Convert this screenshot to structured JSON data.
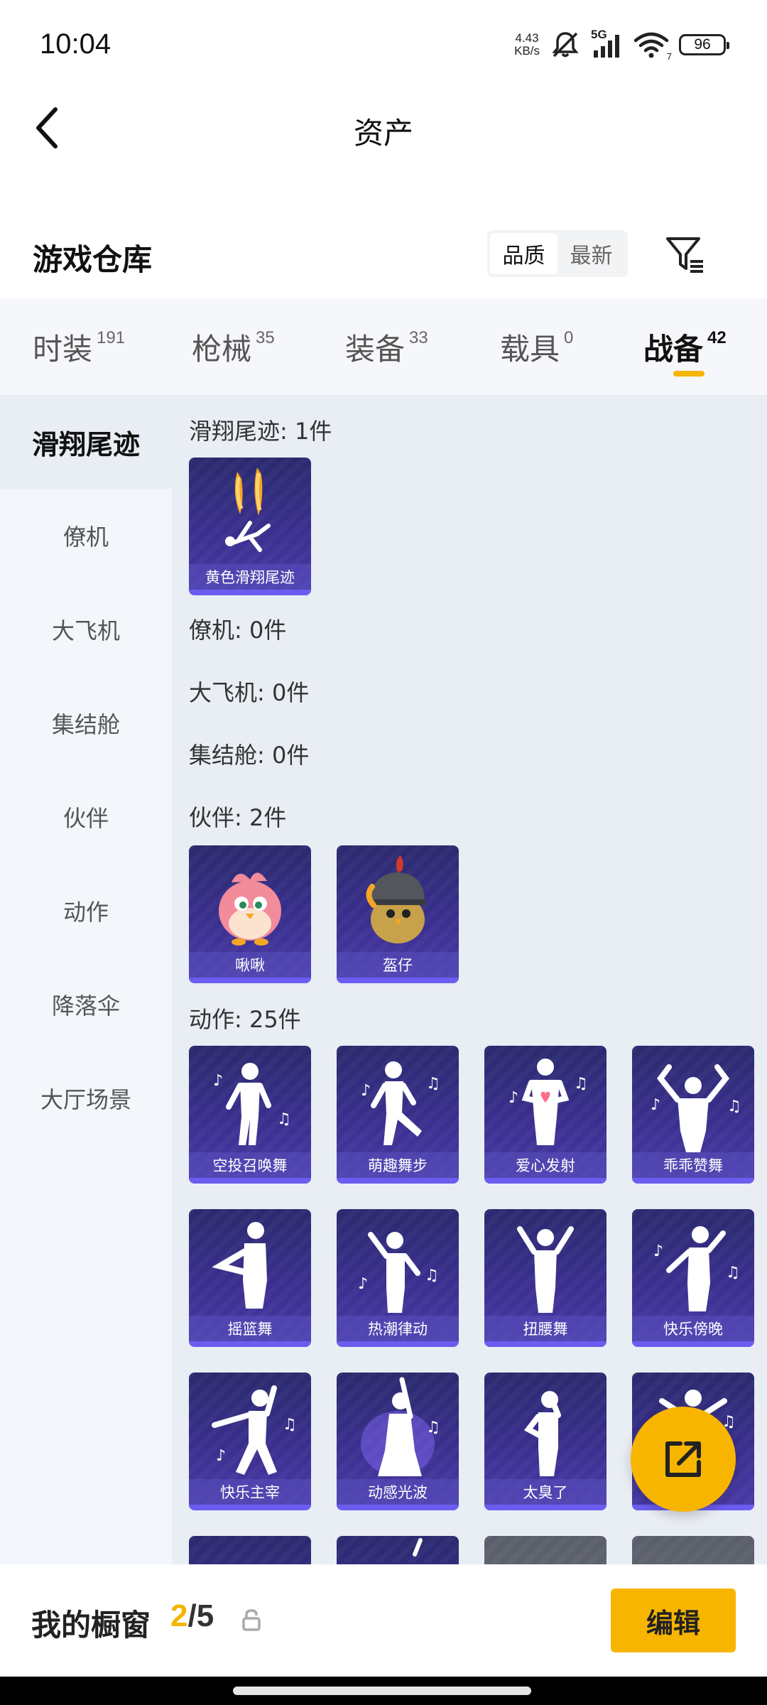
{
  "status_bar": {
    "time": "10:04",
    "net_speed_value": "4.43",
    "net_speed_unit": "KB/s",
    "signal_label": "5G",
    "wifi_badge": "7",
    "battery": "96"
  },
  "header": {
    "title": "资产"
  },
  "section": {
    "title": "游戏仓库",
    "sort_options": [
      "品质",
      "最新"
    ],
    "active_sort": "品质"
  },
  "category_tabs": [
    {
      "label": "时装",
      "count": "191"
    },
    {
      "label": "枪械",
      "count": "35"
    },
    {
      "label": "装备",
      "count": "33"
    },
    {
      "label": "载具",
      "count": "0"
    },
    {
      "label": "战备",
      "count": "42",
      "active": true
    }
  ],
  "sidebar": {
    "items": [
      "滑翔尾迹",
      "僚机",
      "大飞机",
      "集结舱",
      "伙伴",
      "动作",
      "降落伞",
      "大厅场景"
    ],
    "active": "滑翔尾迹"
  },
  "groups": {
    "glide_trail": {
      "title": "滑翔尾迹: 1件",
      "items": [
        "黄色滑翔尾迹"
      ]
    },
    "wingman": {
      "title": "僚机: 0件"
    },
    "big_plane": {
      "title": "大飞机: 0件"
    },
    "assembly_pod": {
      "title": "集结舱: 0件"
    },
    "companion": {
      "title": "伙伴: 2件",
      "items": [
        "啾啾",
        "盔仔"
      ]
    },
    "emote": {
      "title": "动作: 25件",
      "items": [
        "空投召唤舞",
        "萌趣舞步",
        "爱心发射",
        "乖乖赞舞",
        "摇篮舞",
        "热潮律动",
        "扭腰舞",
        "快乐傍晚",
        "快乐主宰",
        "动感光波",
        "太臭了"
      ]
    }
  },
  "bottom_bar": {
    "label": "我的橱窗",
    "current": "2",
    "total": "/5",
    "edit_label": "编辑"
  },
  "colors": {
    "accent": "#F7B500",
    "card_bg": "#3A2F8F",
    "content_bg": "#E9EDF4"
  }
}
